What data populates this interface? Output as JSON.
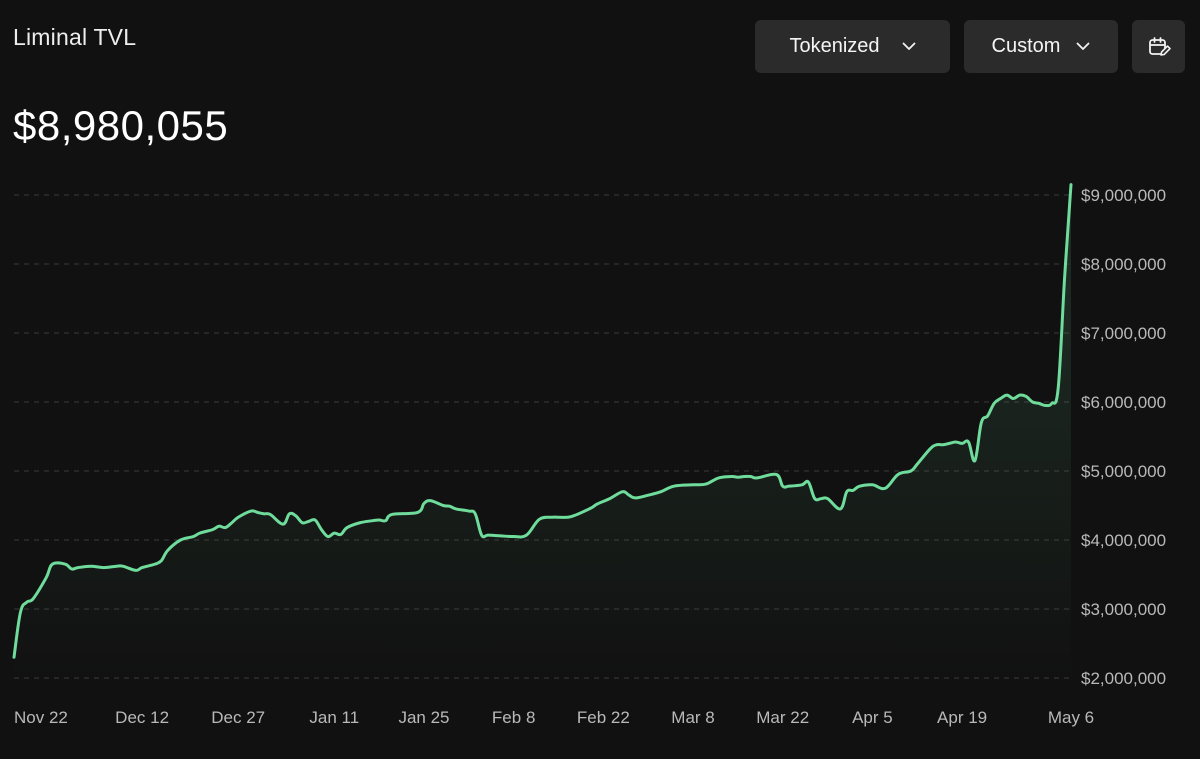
{
  "header": {
    "title": "Liminal TVL",
    "value": "$8,980,055"
  },
  "controls": {
    "asset_filter": "Tokenized",
    "range_filter": "Custom",
    "calendar_icon": "calendar-edit-icon",
    "chevron_icon": "chevron-down-icon"
  },
  "colors": {
    "background": "#111111",
    "line": "#6fdc9c",
    "grid": "#3a3a3a",
    "button": "#2b2b2b"
  },
  "chart_data": {
    "type": "area",
    "title": "",
    "xlabel": "",
    "ylabel": "",
    "ylim": [
      2000000,
      9000000
    ],
    "yticks": [
      2000000,
      3000000,
      4000000,
      5000000,
      6000000,
      7000000,
      8000000,
      9000000
    ],
    "ytick_labels": [
      "$2,000,000",
      "$3,000,000",
      "$4,000,000",
      "$5,000,000",
      "$6,000,000",
      "$7,000,000",
      "$8,000,000",
      "$9,000,000"
    ],
    "xlim": [
      "2024-11-22",
      "2025-05-06"
    ],
    "xticks": [
      "2024-11-22",
      "2024-12-12",
      "2024-12-27",
      "2025-01-11",
      "2025-01-25",
      "2025-02-08",
      "2025-02-22",
      "2025-03-08",
      "2025-03-22",
      "2025-04-05",
      "2025-04-19",
      "2025-05-06"
    ],
    "xtick_labels": [
      "Nov 22",
      "Dec 12",
      "Dec 27",
      "Jan 11",
      "Jan 25",
      "Feb 8",
      "Feb 22",
      "Mar 8",
      "Mar 22",
      "Apr 5",
      "Apr 19",
      "May 6"
    ],
    "grid": "horizontal-dashed",
    "series": [
      {
        "x": [
          "2024-11-22",
          "2024-11-23",
          "2024-11-24",
          "2024-11-25",
          "2024-11-27",
          "2024-11-28",
          "2024-11-30",
          "2024-12-01",
          "2024-12-02",
          "2024-12-04",
          "2024-12-06",
          "2024-12-08",
          "2024-12-09",
          "2024-12-11",
          "2024-12-12",
          "2024-12-14",
          "2024-12-15",
          "2024-12-16",
          "2024-12-18",
          "2024-12-20",
          "2024-12-21",
          "2024-12-23",
          "2024-12-24",
          "2024-12-25",
          "2024-12-26",
          "2024-12-27",
          "2024-12-29",
          "2024-12-30",
          "2024-12-31",
          "2025-01-01",
          "2025-01-03",
          "2025-01-04",
          "2025-01-05",
          "2025-01-06",
          "2025-01-07",
          "2025-01-08",
          "2025-01-09",
          "2025-01-10",
          "2025-01-11",
          "2025-01-12",
          "2025-01-13",
          "2025-01-15",
          "2025-01-17",
          "2025-01-18",
          "2025-01-19",
          "2025-01-20",
          "2025-01-24",
          "2025-01-25",
          "2025-01-26",
          "2025-01-28",
          "2025-01-29",
          "2025-01-30",
          "2025-02-01",
          "2025-02-02",
          "2025-02-03",
          "2025-02-04",
          "2025-02-06",
          "2025-02-08",
          "2025-02-10",
          "2025-02-12",
          "2025-02-14",
          "2025-02-15",
          "2025-02-17",
          "2025-02-20",
          "2025-02-21",
          "2025-02-23",
          "2025-02-25",
          "2025-02-26",
          "2025-02-27",
          "2025-03-01",
          "2025-03-03",
          "2025-03-05",
          "2025-03-08",
          "2025-03-10",
          "2025-03-12",
          "2025-03-14",
          "2025-03-15",
          "2025-03-16",
          "2025-03-17",
          "2025-03-18",
          "2025-03-21",
          "2025-03-22",
          "2025-03-23",
          "2025-03-25",
          "2025-03-26",
          "2025-03-27",
          "2025-03-28",
          "2025-03-29",
          "2025-03-31",
          "2025-04-01",
          "2025-04-02",
          "2025-04-03",
          "2025-04-05",
          "2025-04-07",
          "2025-04-09",
          "2025-04-11",
          "2025-04-12",
          "2025-04-14",
          "2025-04-15",
          "2025-04-16",
          "2025-04-17",
          "2025-04-18",
          "2025-04-19",
          "2025-04-20",
          "2025-04-21",
          "2025-04-22",
          "2025-04-23",
          "2025-04-24",
          "2025-04-25",
          "2025-04-26",
          "2025-04-27",
          "2025-04-28",
          "2025-04-29",
          "2025-04-30",
          "2025-05-01",
          "2025-05-02",
          "2025-05-03",
          "2025-05-04",
          "2025-05-05",
          "2025-05-06"
        ],
        "y": [
          2300000,
          2950000,
          3100000,
          3150000,
          3450000,
          3650000,
          3650000,
          3580000,
          3600000,
          3620000,
          3600000,
          3620000,
          3620000,
          3560000,
          3600000,
          3650000,
          3700000,
          3850000,
          4000000,
          4050000,
          4100000,
          4150000,
          4200000,
          4180000,
          4250000,
          4330000,
          4420000,
          4400000,
          4380000,
          4370000,
          4230000,
          4380000,
          4350000,
          4250000,
          4270000,
          4290000,
          4150000,
          4050000,
          4100000,
          4080000,
          4180000,
          4250000,
          4280000,
          4290000,
          4280000,
          4370000,
          4400000,
          4530000,
          4570000,
          4500000,
          4490000,
          4450000,
          4420000,
          4380000,
          4070000,
          4070000,
          4060000,
          4050000,
          4070000,
          4300000,
          4330000,
          4330000,
          4340000,
          4460000,
          4520000,
          4600000,
          4700000,
          4650000,
          4610000,
          4650000,
          4700000,
          4780000,
          4800000,
          4810000,
          4900000,
          4920000,
          4910000,
          4920000,
          4920000,
          4900000,
          4950000,
          4780000,
          4780000,
          4800000,
          4840000,
          4600000,
          4600000,
          4600000,
          4450000,
          4700000,
          4720000,
          4780000,
          4800000,
          4750000,
          4950000,
          5000000,
          5100000,
          5320000,
          5380000,
          5380000,
          5400000,
          5420000,
          5400000,
          5420000,
          5150000,
          5700000,
          5800000,
          5980000,
          6050000,
          6100000,
          6050000,
          6100000,
          6080000,
          6000000,
          5980000,
          5950000,
          5980000,
          6200000,
          7800000,
          9150000
        ]
      }
    ]
  }
}
